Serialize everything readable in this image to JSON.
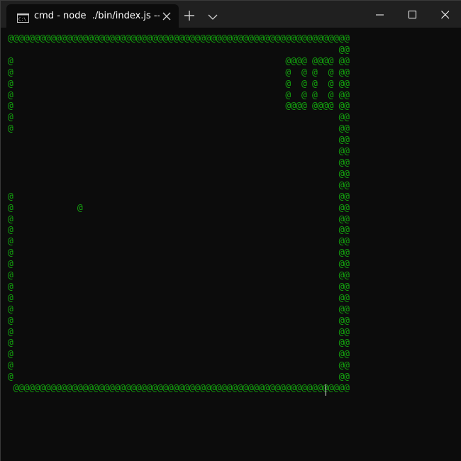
{
  "tab": {
    "title": "cmd - node  ./bin/index.js --rom",
    "icon": "cmd-icon"
  },
  "titlebar": {
    "new_tab_icon": "plus-icon",
    "dropdown_icon": "chevron-down-icon",
    "minimize_icon": "minimize-icon",
    "maximize_icon": "maximize-icon",
    "close_icon": "close-icon"
  },
  "colors": {
    "terminal_bg": "#0c0c0c",
    "text_green": "#13a10e",
    "titlebar_bg": "#202020"
  },
  "terminal": {
    "lines": [
      "@@@@@@@@@@@@@@@@@@@@@@@@@@@@@@@@@@@@@@@@@@@@@@@@@@@@@@@@@@@@@@@@",
      "                                                              @@",
      "@                                                   @@@@ @@@@ @@",
      "@                                                   @  @ @  @ @@",
      "@                                                   @  @ @  @ @@",
      "@                                                   @  @ @  @ @@",
      "@                                                   @@@@ @@@@ @@",
      "@                                                             @@",
      "@                                                             @@",
      "                                                              @@",
      "                                                              @@",
      "                                                              @@",
      "                                                              @@",
      "                                                              @@",
      "@                                                             @@",
      "@            @                                                @@",
      "@                                                             @@",
      "@                                                             @@",
      "@                                                             @@",
      "@                                                             @@",
      "@                                                             @@",
      "@                                                             @@",
      "@                                                             @@",
      "@                                                             @@",
      "@                                                             @@",
      "@                                                             @@",
      "@                                                             @@",
      "@                                                             @@",
      "@                                                             @@",
      "@                                                             @@",
      "@                                                             @@",
      " @@@@@@@@@@@@@@@@@@@@@@@@@@@@@@@@@@@@@@@@@@@@@@@@@@@@@@@@@@@@@@@"
    ]
  }
}
